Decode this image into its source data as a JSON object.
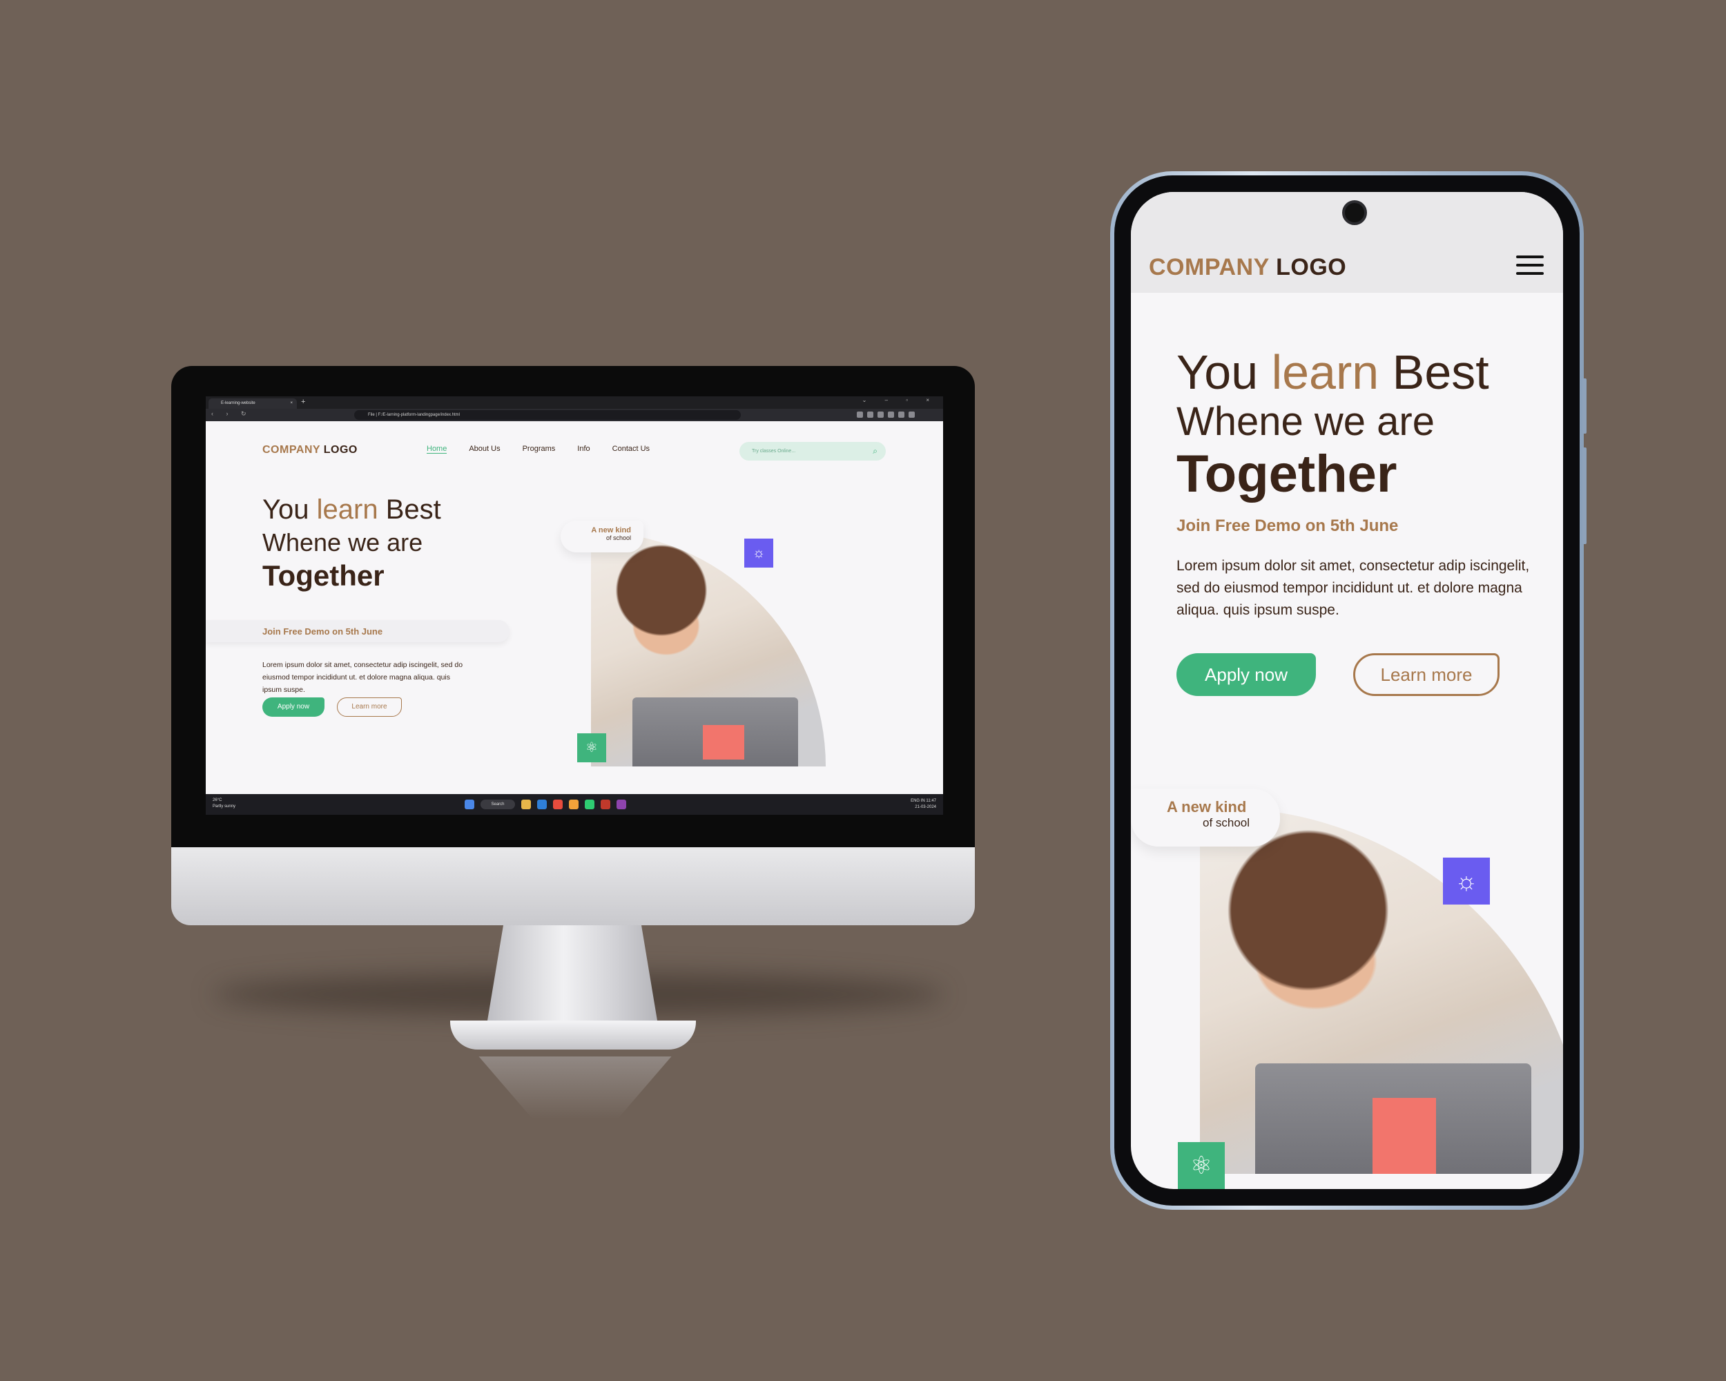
{
  "colors": {
    "background": "#6f6157",
    "brand_brown": "#a7784c",
    "dark_text": "#3a2418",
    "accent_green": "#3fb47d",
    "accent_purple": "#6a5cf0"
  },
  "desktop": {
    "browser": {
      "tab_title": "E-learning-website",
      "url": "File  |  F:/E-larning-platform-landingpage/index.html"
    },
    "site": {
      "logo_company": "COMPANY",
      "logo_word": "LOGO",
      "nav": [
        "Home",
        "About Us",
        "Programs",
        "Info",
        "Contact Us"
      ],
      "search_placeholder": "Try classes Online...",
      "hero": {
        "line1_a": "You ",
        "line1_b": "learn",
        "line1_c": " Best",
        "line2": "Whene we are",
        "line3": "Together",
        "demo": "Join Free Demo on 5th June",
        "lorem": "Lorem ipsum dolor sit amet, consectetur adip iscingelit, sed do eiusmod tempor incididunt ut. et dolore magna aliqua. quis ipsum suspe.",
        "apply": "Apply now",
        "learn_more": "Learn more",
        "new_kind": "A new kind",
        "of_school": "of school"
      }
    },
    "taskbar": {
      "weather_temp": "26°C",
      "weather_desc": "Partly sunny",
      "search": "Search",
      "lang": "ENG IN",
      "time": "11:47",
      "date": "21-03-2024"
    }
  },
  "mobile": {
    "logo_company": "COMPANY",
    "logo_word": "LOGO",
    "menu_icon": "hamburger-menu-icon",
    "hero": {
      "line1_a": "You ",
      "line1_b": "learn",
      "line1_c": " Best",
      "line2": "Whene we are",
      "line3": "Together",
      "demo": "Join Free Demo on 5th June",
      "lorem": "Lorem ipsum dolor sit amet, consectetur adip iscingelit, sed do eiusmod tempor incididunt ut. et dolore magna aliqua. quis ipsum suspe.",
      "apply": "Apply now",
      "learn_more": "Learn more",
      "new_kind": "A new kind",
      "of_school": "of school"
    }
  }
}
